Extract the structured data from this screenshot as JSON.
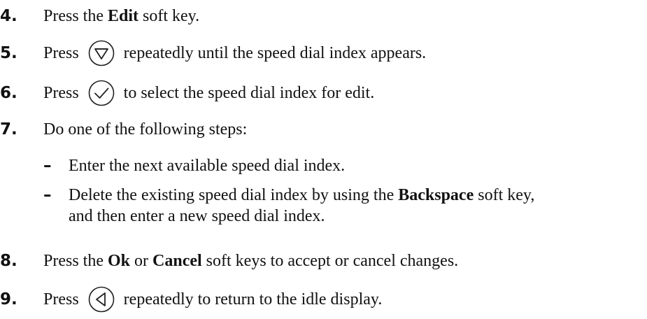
{
  "steps": [
    {
      "num": "4.",
      "pre": "Press the ",
      "bold": "Edit",
      "post": " soft key."
    },
    {
      "num": "5.",
      "pre": "Press",
      "icon": "down-arrow-button-icon",
      "post": "repeatedly until the speed dial index appears."
    },
    {
      "num": "6.",
      "pre": "Press",
      "icon": "select-check-button-icon",
      "post": "to select the speed dial index for edit."
    },
    {
      "num": "7.",
      "text": "Do one of the following steps:"
    },
    {
      "num": "8.",
      "pre": "Press the ",
      "bold1": "Ok",
      "mid": " or ",
      "bold2": "Cancel",
      "post": " soft keys to accept or cancel changes."
    },
    {
      "num": "9.",
      "pre": "Press",
      "icon": "left-arrow-button-icon",
      "post": "repeatedly to return to the idle display."
    }
  ],
  "substeps": [
    {
      "dash": "–",
      "text": "Enter the next available speed dial index."
    },
    {
      "dash": "–",
      "pre": "Delete the existing speed dial index by using the ",
      "bold": "Backspace",
      "post": " soft key,",
      "line2": "and then enter a new speed dial index."
    }
  ]
}
